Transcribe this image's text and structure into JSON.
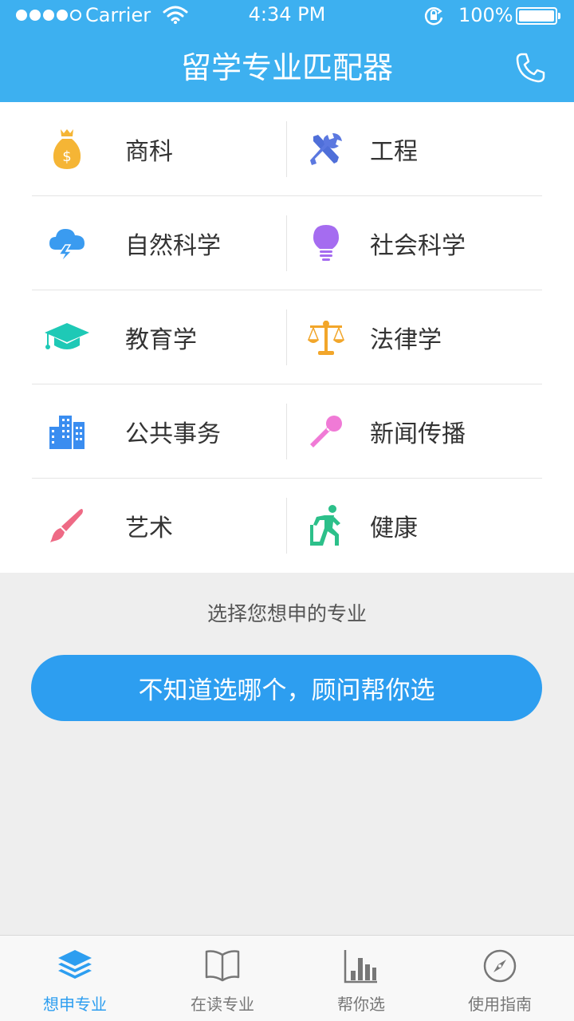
{
  "status": {
    "carrier": "Carrier",
    "time": "4:34 PM",
    "battery": "100%"
  },
  "header": {
    "title": "留学专业匹配器"
  },
  "majors": [
    {
      "label": "商科",
      "icon": "money-bag-icon",
      "color": "#f5b535"
    },
    {
      "label": "工程",
      "icon": "tools-icon",
      "color": "#4f6fd9"
    },
    {
      "label": "自然科学",
      "icon": "cloud-lightning-icon",
      "color": "#3a9bf0"
    },
    {
      "label": "社会科学",
      "icon": "lightbulb-icon",
      "color": "#a56cf0"
    },
    {
      "label": "教育学",
      "icon": "graduation-cap-icon",
      "color": "#1ec9b6"
    },
    {
      "label": "法律学",
      "icon": "scales-icon",
      "color": "#f2a62a"
    },
    {
      "label": "公共事务",
      "icon": "buildings-icon",
      "color": "#3a8df0"
    },
    {
      "label": "新闻传播",
      "icon": "microphone-icon",
      "color": "#f07ad6"
    },
    {
      "label": "艺术",
      "icon": "paintbrush-icon",
      "color": "#ee6a85"
    },
    {
      "label": "健康",
      "icon": "running-person-icon",
      "color": "#2cc08a"
    }
  ],
  "main": {
    "hint": "选择您想申的专业",
    "cta_label": "不知道选哪个，顾问帮你选"
  },
  "tabs": [
    {
      "label": "想申专业",
      "icon": "layers-icon",
      "active": true
    },
    {
      "label": "在读专业",
      "icon": "open-book-icon",
      "active": false
    },
    {
      "label": "帮你选",
      "icon": "bar-chart-icon",
      "active": false
    },
    {
      "label": "使用指南",
      "icon": "compass-icon",
      "active": false
    }
  ],
  "colors": {
    "header": "#3db0f0",
    "accent": "#2d9ef0"
  }
}
